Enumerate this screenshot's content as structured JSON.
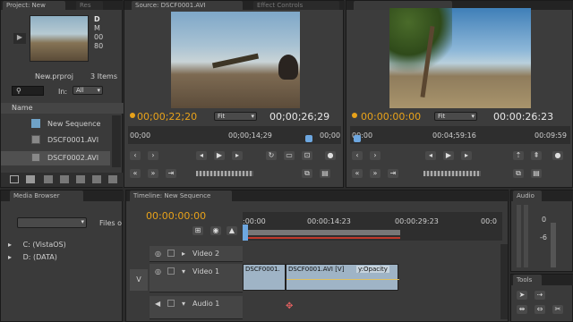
{
  "project": {
    "tabs": [
      "Project: New",
      "Res"
    ],
    "clip_info": [
      "D",
      "M",
      "00",
      "80"
    ],
    "filename": "New.prproj",
    "items_count": "3 Items",
    "in_label": "In:",
    "in_value": "All",
    "name_header": "Name",
    "items": [
      "New Sequence",
      "DSCF0001.AVI",
      "DSCF0002.AVI"
    ]
  },
  "source": {
    "tab": "Source: DSCF0001.AVI",
    "tab2": "Effect Controls",
    "tc_in": "00;00;22;20",
    "fit": "Fit",
    "tc_dur": "00;00;26;29",
    "ruler": [
      "00;00",
      "00;00;14;29",
      "00;00"
    ]
  },
  "program": {
    "tc_in": "00:00:00:00",
    "fit": "Fit",
    "tc_dur": "00:00:26:23",
    "ruler": [
      "00:00",
      "00:04;59:16",
      "00:09:59"
    ]
  },
  "media_browser": {
    "tab": "Media Browser",
    "files_label": "Files o",
    "drives": [
      "C: (VistaOS)",
      "D: (DATA)"
    ]
  },
  "timeline": {
    "tab": "Timeline: New Sequence",
    "tc": "00:00:00:00",
    "ruler": [
      ":00:00",
      "00:00:14:23",
      "00:00:29:23",
      "00:0"
    ],
    "tracks": [
      "Video 2",
      "Video 1",
      "Audio 1"
    ],
    "v_label": "V",
    "clips": [
      "DSCF0001.",
      "DSCF0001.AVI [V]",
      "y:Opacity"
    ]
  },
  "audio": {
    "tab": "Audio",
    "level": "0",
    "level2": "-6"
  },
  "tools": {
    "tab": "Tools"
  }
}
